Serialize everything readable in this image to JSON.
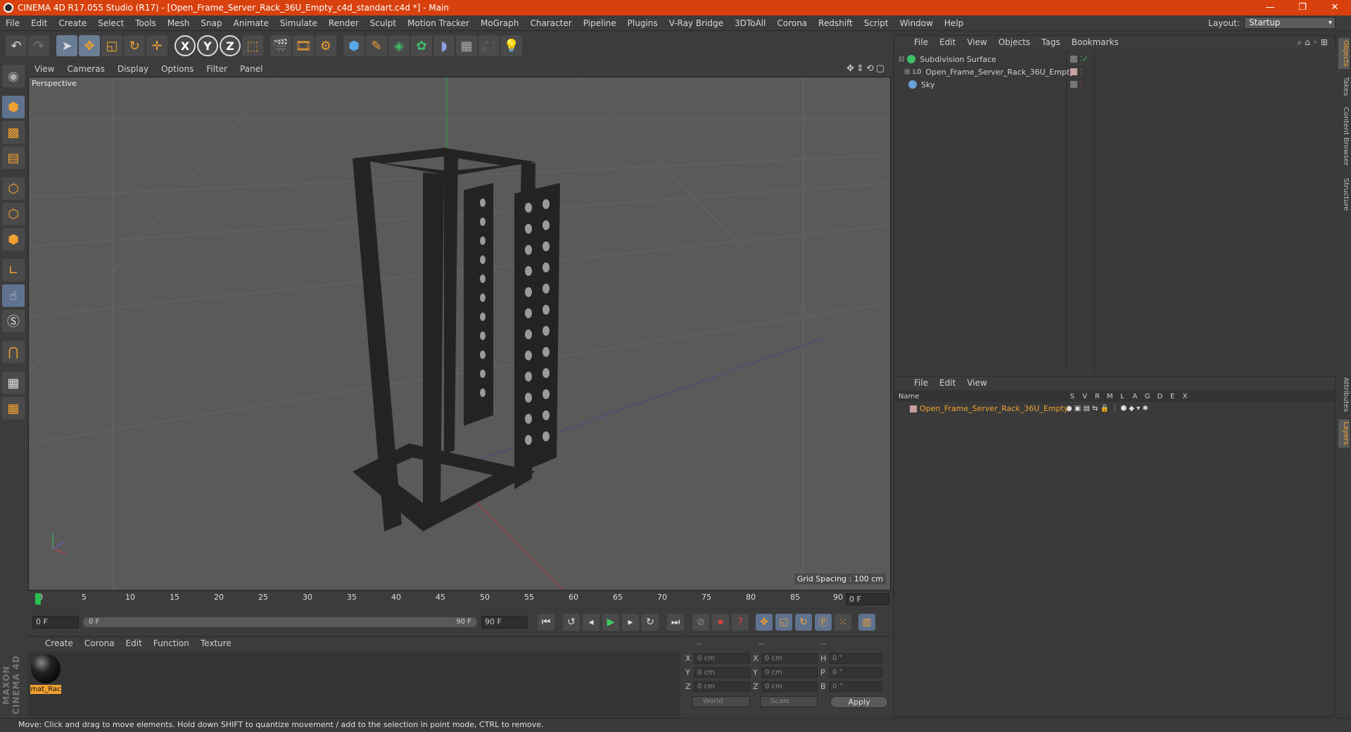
{
  "window": {
    "title": "CINEMA 4D R17.055 Studio (R17) - [Open_Frame_Server_Rack_36U_Empty_c4d_standart.c4d *] - Main",
    "buttons": [
      "—",
      "❐",
      "✕"
    ]
  },
  "menubar": {
    "items": [
      "File",
      "Edit",
      "Create",
      "Select",
      "Tools",
      "Mesh",
      "Snap",
      "Animate",
      "Simulate",
      "Render",
      "Sculpt",
      "Motion Tracker",
      "MoGraph",
      "Character",
      "Pipeline",
      "Plugins",
      "V-Ray Bridge",
      "3DToAll",
      "Corona",
      "Redshift",
      "Script",
      "Window",
      "Help"
    ],
    "layout_label": "Layout:",
    "layout_value": "Startup"
  },
  "toolbar": {
    "icons": [
      "undo-icon",
      "redo-icon",
      "select-arrow-icon",
      "move-icon",
      "scale-icon",
      "rotate-icon",
      "transform-icon",
      "x-axis",
      "y-axis",
      "z-axis",
      "coordinate-system-icon",
      "render-view-icon",
      "render-picture-icon",
      "render-settings-icon",
      "cube-icon",
      "pen-spline-icon",
      "subdivision-icon",
      "cloner-icon",
      "deformer-icon",
      "floor-icon",
      "camera-icon",
      "light-icon"
    ],
    "axis_labels": [
      "X",
      "Y",
      "Z"
    ]
  },
  "viewport": {
    "menu": [
      "View",
      "Cameras",
      "Display",
      "Options",
      "Filter",
      "Panel"
    ],
    "camera_label": "Perspective",
    "grid_spacing": "Grid Spacing : 100 cm"
  },
  "timeline": {
    "ticks": [
      "0",
      "5",
      "10",
      "15",
      "20",
      "25",
      "30",
      "35",
      "40",
      "45",
      "50",
      "55",
      "60",
      "65",
      "70",
      "75",
      "80",
      "85",
      "90"
    ],
    "current_frame": "0 F"
  },
  "transport": {
    "start_field": "0 F",
    "range_start": "0 F",
    "range_end": "90 F",
    "end_field": "90 F"
  },
  "material_manager": {
    "menu": [
      "Create",
      "Corona",
      "Edit",
      "Function",
      "Texture"
    ],
    "materials": [
      {
        "name": "mat_Rac"
      }
    ]
  },
  "coordinates": {
    "headers": [
      "--",
      "--",
      "--"
    ],
    "rows": [
      {
        "a": "X",
        "v1": "0 cm",
        "b": "X",
        "v2": "0 cm",
        "c": "H",
        "v3": "0 °"
      },
      {
        "a": "Y",
        "v1": "0 cm",
        "b": "Y",
        "v2": "0 cm",
        "c": "P",
        "v3": "0 °"
      },
      {
        "a": "Z",
        "v1": "0 cm",
        "b": "Z",
        "v2": "0 cm",
        "c": "B",
        "v3": "0 °"
      }
    ],
    "space": "World",
    "mode": "Scale",
    "apply": "Apply"
  },
  "object_manager": {
    "menu": [
      "File",
      "Edit",
      "View",
      "Objects",
      "Tags",
      "Bookmarks"
    ],
    "objects": [
      {
        "name": "Subdivision Surface",
        "icon_color": "#3fbf6a",
        "indent": 0
      },
      {
        "name": "Open_Frame_Server_Rack_36U_Empty",
        "icon_color": "#cccccc",
        "indent": 1
      },
      {
        "name": "Sky",
        "icon_color": "#6aa0d8",
        "indent": 0
      }
    ]
  },
  "layer_manager": {
    "menu": [
      "File",
      "Edit",
      "View"
    ],
    "columns": [
      "Name",
      "S",
      "V",
      "R",
      "M",
      "L",
      "A",
      "G",
      "D",
      "E",
      "X"
    ],
    "layers": [
      {
        "name": "Open_Frame_Server_Rack_36U_Empty"
      }
    ]
  },
  "right_tabs": [
    "Objects",
    "Takes",
    "Content Browser",
    "Structure",
    "Attributes",
    "Layers"
  ],
  "status": "Move: Click and drag to move elements. Hold down SHIFT to quantize movement / add to the selection in point mode, CTRL to remove.",
  "branding": "MAXON CINEMA 4D",
  "colors": {
    "accent": "#d8410e",
    "highlight": "#f0a030"
  }
}
